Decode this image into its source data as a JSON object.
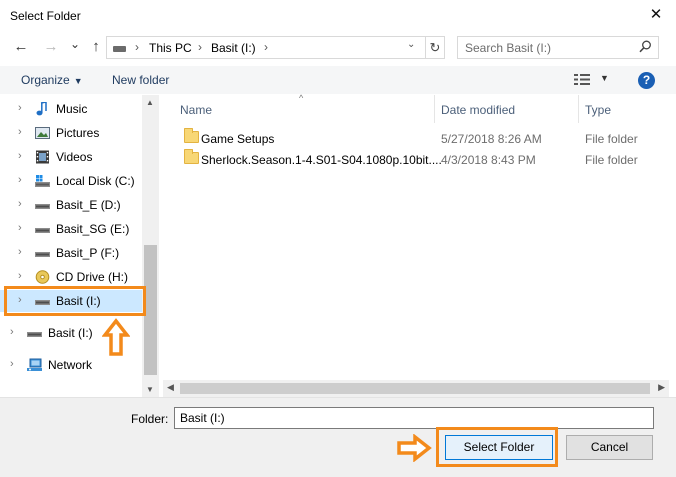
{
  "window": {
    "title": "Select Folder",
    "close_glyph": "✕"
  },
  "nav": {
    "back_glyph": "←",
    "forward_glyph": "→",
    "recent_glyph": "⌄",
    "up_glyph": "↑",
    "breadcrumb": [
      "This PC",
      "Basit (I:)"
    ],
    "refresh_glyph": "↻",
    "search_placeholder": "Search Basit (I:)"
  },
  "toolbar": {
    "organize_label": "Organize",
    "new_folder_label": "New folder",
    "help_label": "?"
  },
  "sidebar": {
    "items": [
      {
        "label": "Music",
        "icon": "music-icon"
      },
      {
        "label": "Pictures",
        "icon": "pictures-icon"
      },
      {
        "label": "Videos",
        "icon": "videos-icon"
      },
      {
        "label": "Local Disk (C:)",
        "icon": "local-disk-icon"
      },
      {
        "label": "Basit_E (D:)",
        "icon": "drive-icon"
      },
      {
        "label": "Basit_SG (E:)",
        "icon": "drive-icon"
      },
      {
        "label": "Basit_P (F:)",
        "icon": "drive-icon"
      },
      {
        "label": "CD Drive (H:)",
        "icon": "cd-drive-icon"
      },
      {
        "label": "Basit (I:)",
        "icon": "drive-icon",
        "selected": true
      },
      {
        "label": "Basit (I:)",
        "icon": "drive-icon"
      },
      {
        "label": "Network",
        "icon": "network-icon"
      }
    ]
  },
  "file_list": {
    "columns": [
      "Name",
      "Date modified",
      "Type"
    ],
    "rows": [
      {
        "name": "Game Setups",
        "date": "5/27/2018 8:26 AM",
        "type": "File folder"
      },
      {
        "name": "Sherlock.Season.1-4.S01-S04.1080p.10bit....",
        "date": "4/3/2018 8:43 PM",
        "type": "File folder"
      }
    ]
  },
  "footer": {
    "folder_label": "Folder:",
    "folder_value": "Basit (I:)",
    "select_button": "Select Folder",
    "cancel_button": "Cancel"
  },
  "colors": {
    "highlight": "#f38a1b",
    "selection": "#cce8ff",
    "primary_border": "#0078d7"
  }
}
